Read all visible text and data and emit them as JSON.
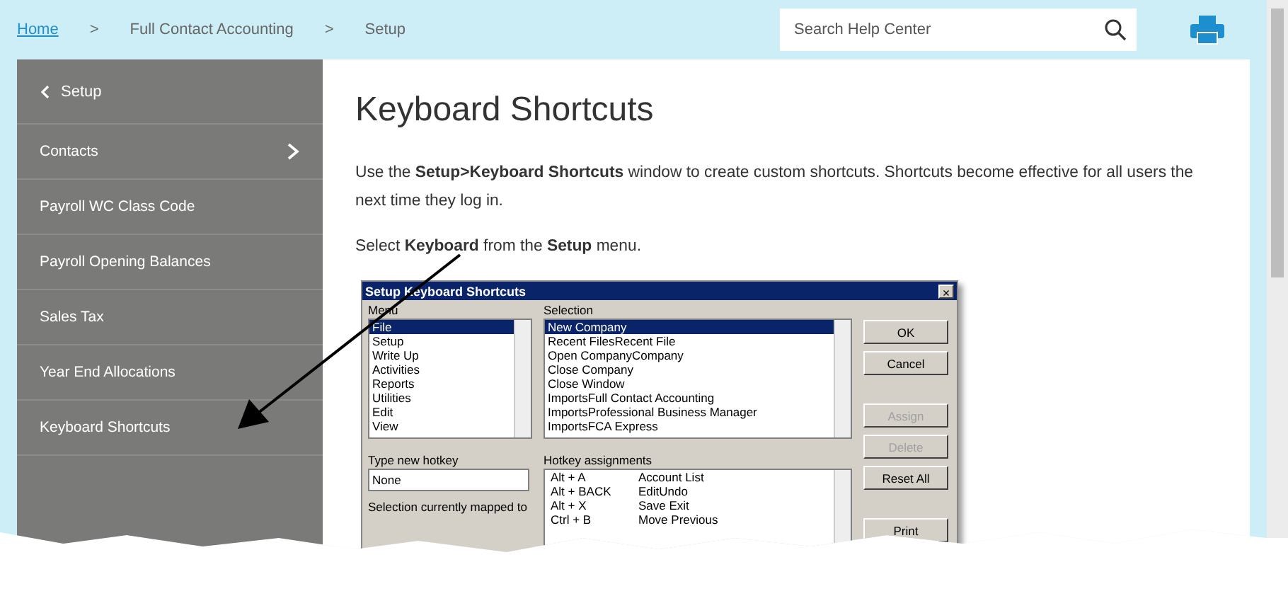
{
  "breadcrumb": [
    {
      "kind": "link",
      "label": "Home"
    },
    {
      "kind": "separator",
      "label": ">"
    },
    {
      "kind": "text",
      "label": "Full Contact Accounting"
    },
    {
      "kind": "separator",
      "label": ">"
    },
    {
      "kind": "text",
      "label": "Setup"
    }
  ],
  "search": {
    "placeholder": "Search Help Center"
  },
  "sidebar": {
    "back": {
      "label": "Setup"
    },
    "items": [
      {
        "label": "Contacts",
        "kind": "submenu"
      },
      {
        "label": "Payroll WC Class Code",
        "kind": "link"
      },
      {
        "label": "Payroll Opening Balances",
        "kind": "link"
      },
      {
        "label": "Sales Tax",
        "kind": "link"
      },
      {
        "label": "Year End Allocations",
        "kind": "link"
      },
      {
        "label": "Keyboard Shortcuts",
        "kind": "link"
      }
    ]
  },
  "article": {
    "title": "Keyboard Shortcuts",
    "paragraphs": [
      "Use the **Setup>Keyboard Shortcuts** window to create custom shortcuts. Shortcuts become effective for all users the next time they log in.",
      "Select **Keyboard** from the **Setup** menu."
    ],
    "dialog": {
      "title": "Setup Keyboard Shortcuts",
      "close": "×",
      "menu_label": "Menu",
      "menu_items": [
        {
          "label": "File",
          "selected": true
        },
        {
          "label": "Setup",
          "selected": false
        },
        {
          "label": "Write Up",
          "selected": false
        },
        {
          "label": "Activities",
          "selected": false
        },
        {
          "label": "Reports",
          "selected": false
        },
        {
          "label": "Utilities",
          "selected": false
        },
        {
          "label": "Edit",
          "selected": false
        },
        {
          "label": "View",
          "selected": false
        }
      ],
      "selection_label": "Selection",
      "selection_items": [
        {
          "label": "New Company",
          "selected": true
        },
        {
          "label": "Recent FilesRecent File",
          "selected": false
        },
        {
          "label": "Open CompanyCompany",
          "selected": false
        },
        {
          "label": "Close Company",
          "selected": false
        },
        {
          "label": "Close Window",
          "selected": false
        },
        {
          "label": "ImportsFull Contact Accounting",
          "selected": false
        },
        {
          "label": "ImportsProfessional Business Manager",
          "selected": false
        },
        {
          "label": "ImportsFCA Express",
          "selected": false
        }
      ],
      "hotkey_label": "Type new hotkey",
      "hotkey_value": "None",
      "assignments_label": "Hotkey assignments",
      "assignments": [
        {
          "key": "Alt + A",
          "command": "Account List"
        },
        {
          "key": "Alt + BACK",
          "command": "EditUndo"
        },
        {
          "key": "Alt + X",
          "command": "Save Exit"
        },
        {
          "key": "Ctrl + B",
          "command": "Move Previous"
        }
      ],
      "mapped_label": "Selection currently mapped to",
      "buttons": [
        {
          "label": "OK",
          "disabled": false
        },
        {
          "label": "Cancel",
          "disabled": false
        },
        {
          "label": "Assign",
          "disabled": true
        },
        {
          "label": "Delete",
          "disabled": true
        },
        {
          "label": "Reset All",
          "disabled": false
        },
        {
          "label": "Print",
          "disabled": false
        }
      ]
    }
  }
}
